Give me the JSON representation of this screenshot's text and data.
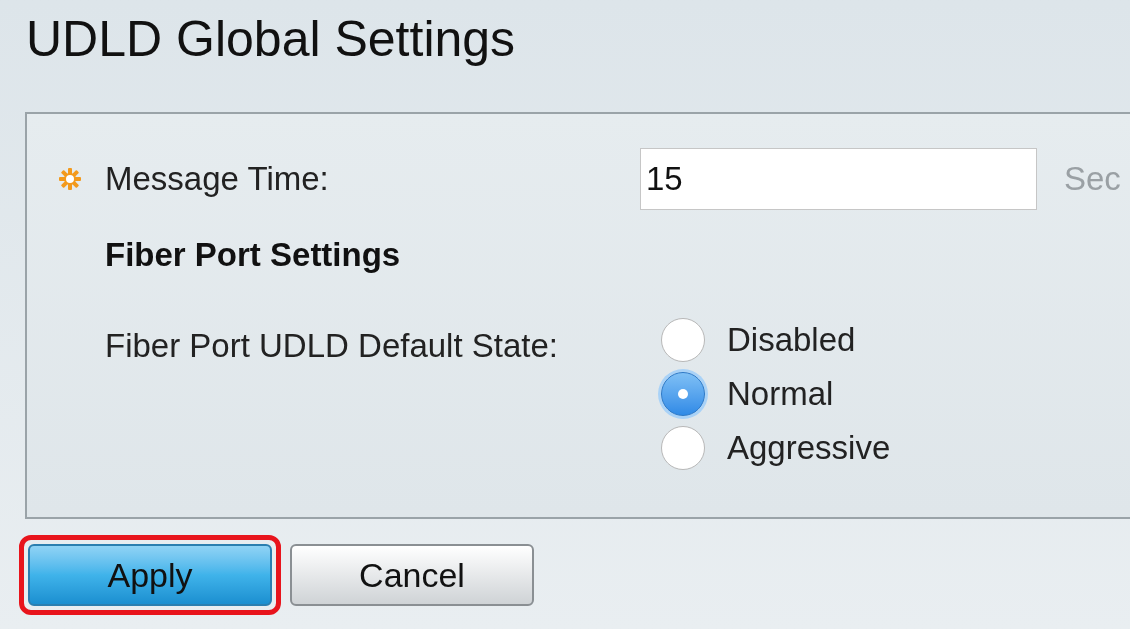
{
  "title": "UDLD Global Settings",
  "message_time": {
    "label": "Message Time:",
    "required": true,
    "value": "15",
    "unit": "Sec"
  },
  "section_title": "Fiber Port Settings",
  "default_state": {
    "label": "Fiber Port UDLD Default State:",
    "options": [
      {
        "label": "Disabled",
        "selected": false
      },
      {
        "label": "Normal",
        "selected": true
      },
      {
        "label": "Aggressive",
        "selected": false
      }
    ]
  },
  "buttons": [
    {
      "label": "Apply",
      "kind": "primary",
      "highlighted": true
    },
    {
      "label": "Cancel",
      "kind": "secondary",
      "highlighted": false
    }
  ]
}
